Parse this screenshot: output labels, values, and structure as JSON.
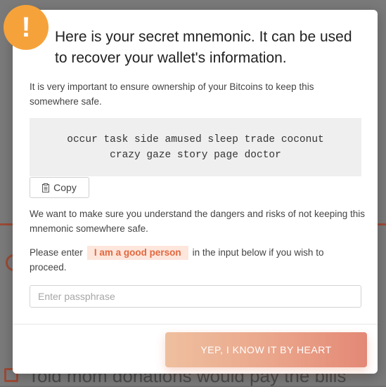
{
  "dialog": {
    "alert_icon_glyph": "!",
    "title": "Here is your secret mnemonic. It can be used to recover your wallet's information.",
    "intro": "It is very important to ensure ownership of your Bitcoins to keep this somewhere safe.",
    "mnemonic": "occur task side amused sleep trade coconut crazy gaze story page doctor",
    "copy_label": "Copy",
    "warning": "We want to make sure you understand the dangers and risks of not keeping this mnemonic somewhere safe.",
    "instruction_before": "Please enter",
    "passphrase": "I am a good person",
    "instruction_after": "in the input below if you wish to proceed.",
    "input_placeholder": "Enter passphrase",
    "input_value": "",
    "confirm_label": "YEP, I KNOW IT BY HEART"
  },
  "background": {
    "lower_text": "Told mom donations would pay the bills"
  },
  "colors": {
    "alert_orange": "#f6a23b",
    "chip_bg": "#fde6dc",
    "chip_text": "#e2683f",
    "button_start": "#e8a677",
    "button_end": "#d9573d"
  },
  "icons": {
    "alert": "exclamation-icon",
    "copy": "clipboard-icon"
  }
}
